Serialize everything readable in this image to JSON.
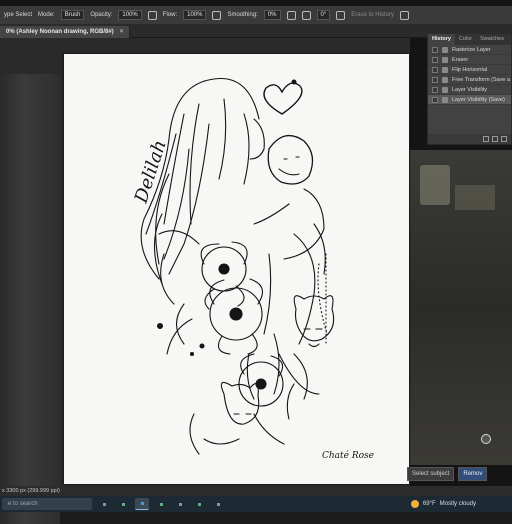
{
  "options_bar": {
    "menu_fragment": "ype Select",
    "mode_label": "Mode:",
    "mode_value": "Brush",
    "opacity_label": "Opacity:",
    "opacity_value": "100%",
    "flow_label": "Flow:",
    "flow_value": "100%",
    "smoothing_label": "Smoothing:",
    "smoothing_value": "0%",
    "angle_value": "0°",
    "erase_to_history": "Erase to History"
  },
  "document_tab": {
    "title": "0% (Ashley Noonan drawing, RGB/8#)",
    "close": "×"
  },
  "history_panel": {
    "tabs": [
      "History",
      "Color",
      "Swatches"
    ],
    "active_tab": "History",
    "items": [
      {
        "label": "Rasterize Layer"
      },
      {
        "label": "Eraser"
      },
      {
        "label": "Flip Horizontal"
      },
      {
        "label": "Free Transform (Save a"
      },
      {
        "label": "Layer Visibility"
      },
      {
        "label": "Layer Visibility (Save)"
      }
    ]
  },
  "artwork": {
    "name_script": "Delilah",
    "signature": "Chaté Rose"
  },
  "context_bar": {
    "select_subject": "Select subject",
    "remove": "Remov"
  },
  "status_bar": {
    "text": "x 3300 px (299.999 ppi)"
  },
  "taskbar": {
    "search_placeholder": "e to search",
    "weather_temp": "69°F",
    "weather_desc": "Mostly cloudy"
  },
  "colors": {
    "panel_bg": "#424242",
    "canvas_bg": "#f7f7f5",
    "accent_blue": "#314e7a",
    "taskbar_bg": "#1e2a33"
  }
}
